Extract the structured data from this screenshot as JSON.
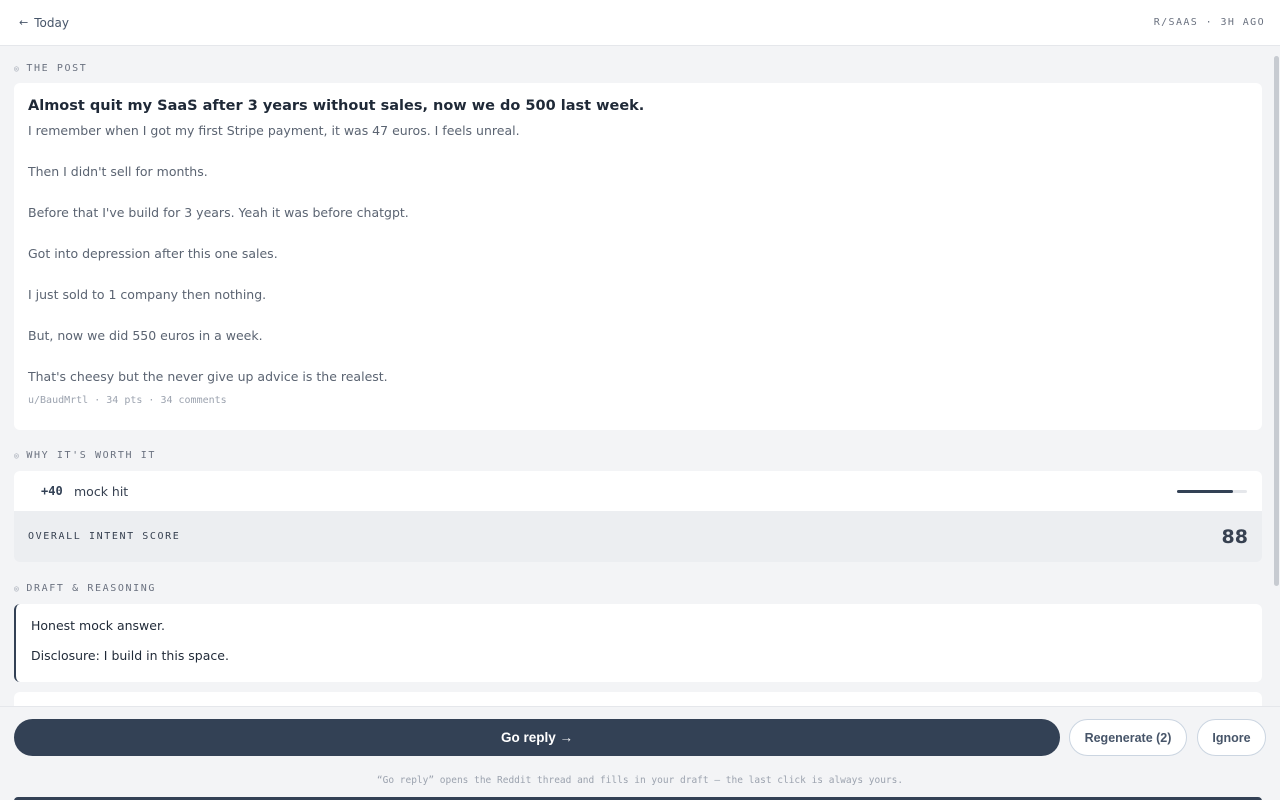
{
  "topbar": {
    "back_arrow": "←",
    "back_label": "Today",
    "meta": "R/SAAS · 3H AGO"
  },
  "sections": {
    "post_label": "THE POST",
    "why_label": "WHY IT'S WORTH IT",
    "draft_label": "DRAFT & REASONING"
  },
  "post": {
    "title": "Almost quit my SaaS after 3 years without sales, now we do 500 last week.",
    "paragraphs": [
      "I remember when I got my first Stripe payment, it was 47 euros. I feels unreal.",
      "Then I didn't sell for months.",
      "Before that I've build for 3 years. Yeah it was before chatgpt.",
      "Got into depression after this one sales.",
      "I just sold to 1 company then nothing.",
      "But, now we did 550 euros in a week.",
      "That's cheesy but the never give up advice is the realest."
    ],
    "meta": "u/BaudMrtl · 34 pts · 34 comments"
  },
  "why": {
    "items": [
      {
        "delta": "+40",
        "label": "mock hit",
        "strength": 0.8
      }
    ],
    "score_label": "OVERALL INTENT SCORE",
    "score_value": "88"
  },
  "draft": {
    "lines": [
      "Honest mock answer.",
      "Disclosure: I build in this space."
    ]
  },
  "actions": {
    "go_reply": "Go reply →",
    "regenerate": "Regenerate (2)",
    "ignore": "Ignore",
    "hint": "“Go reply” opens the Reddit thread and fills in your draft — the last click is always yours."
  },
  "colors": {
    "primary": "#334155",
    "background": "#f3f4f6",
    "card": "#ffffff"
  }
}
